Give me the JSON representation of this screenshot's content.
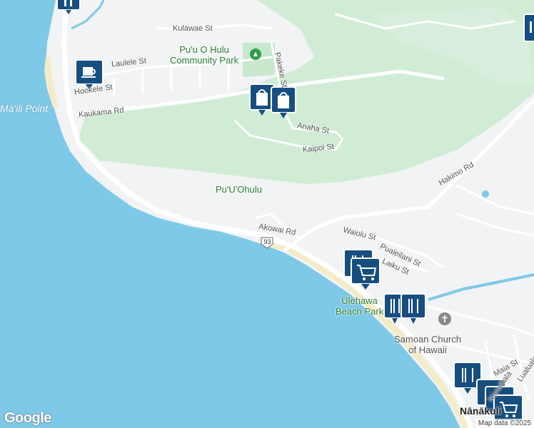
{
  "map": {
    "colors": {
      "ocean": "#7fc9e8",
      "land": "#f1f3f4",
      "park": "#d0ecd5",
      "beach": "#f3ecc7",
      "road": "#ffffff",
      "marker": "#174e80"
    },
    "places": {
      "malli_point": "Mā'ili Point",
      "puu_ohulu": "Pu'U'Ohulu",
      "community_park_line1": "Pu'u O Hulu",
      "community_park_line2": "Community Park",
      "beach_park_line1": "Ulehawa",
      "beach_park_line2": "Beach Park",
      "church_line1": "Samoan Church",
      "church_line2": "of Hawaii",
      "town": "Nānākuli"
    },
    "streets": {
      "kulawae": "Kulawae St",
      "laulele": "Laulele St",
      "hookele": "Hookele St",
      "kaukama": "Kaukama Rd",
      "pakeke": "Pakeke St",
      "anaha": "Anaha St",
      "kaipoi": "Kaipoi St",
      "hakimo": "Hakimo Rd",
      "akowai": "Akowai Rd",
      "waiolu": "Waiolu St",
      "pualeilani": "Pualeilani St",
      "laiku": "Laiku St",
      "maia": "Maia St",
      "lualualei": "Lualualei",
      "nanaikala": "Nanaikala"
    },
    "route_shield": "93",
    "markers": [
      {
        "type": "pin",
        "icon": "map-pin-icon"
      },
      {
        "type": "cafe",
        "icon": "coffee-cup-icon"
      },
      {
        "type": "shopping",
        "icon": "shopping-bag-icon"
      },
      {
        "type": "shopping",
        "icon": "shopping-bag-icon"
      },
      {
        "type": "pin",
        "icon": "map-pin-icon"
      },
      {
        "type": "restaurant",
        "icon": "fork-knife-icon"
      },
      {
        "type": "grocery",
        "icon": "shopping-cart-icon"
      },
      {
        "type": "restaurant",
        "icon": "fork-knife-icon"
      },
      {
        "type": "restaurant",
        "icon": "fork-knife-icon"
      },
      {
        "type": "restaurant",
        "icon": "fork-knife-icon"
      },
      {
        "type": "grocery",
        "icon": "shopping-cart-icon"
      }
    ],
    "logo": "Google",
    "attribution": "Map data ©2025"
  }
}
